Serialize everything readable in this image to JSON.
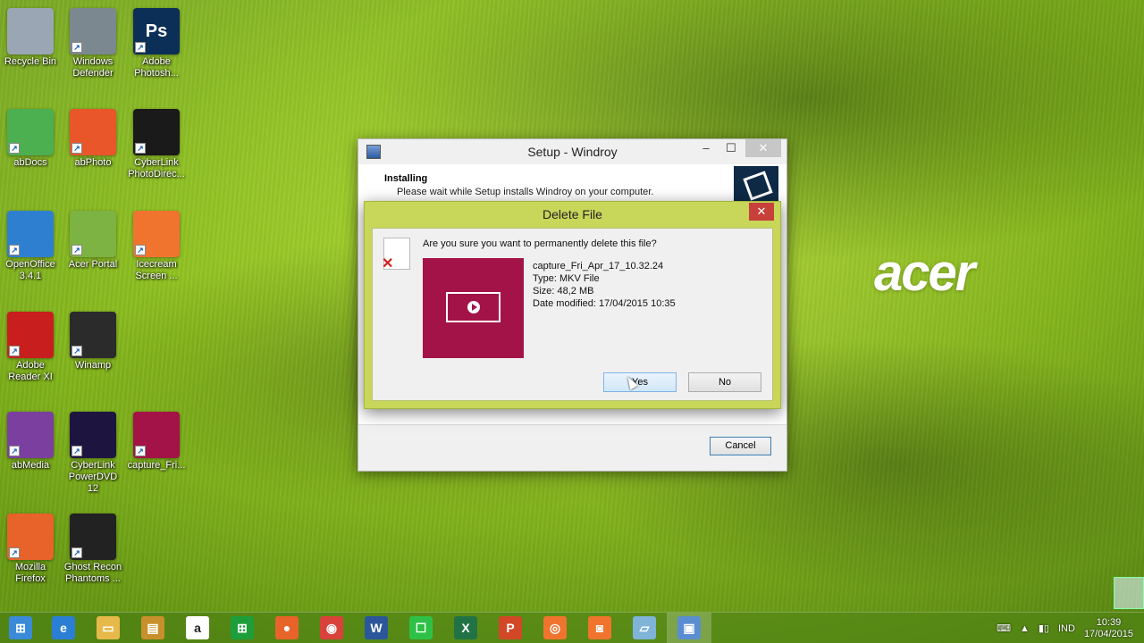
{
  "desktop": {
    "icons": [
      {
        "label": "Recycle Bin",
        "icon": "recycle-bin-icon",
        "color": "#9aa6b3"
      },
      {
        "label": "Windows Defender",
        "icon": "windows-defender-icon",
        "color": "#7c8890"
      },
      {
        "label": "Adobe Photosh...",
        "icon": "photoshop-icon",
        "color": "#0c2f57",
        "glyph": "Ps"
      },
      {
        "label": "abDocs",
        "icon": "abdocs-icon",
        "color": "#4caf50"
      },
      {
        "label": "abPhoto",
        "icon": "abphoto-icon",
        "color": "#e8562a"
      },
      {
        "label": "CyberLink PhotoDirec...",
        "icon": "cyberlink-photodirector-icon",
        "color": "#1a1a1a"
      },
      {
        "label": "OpenOffice 3.4.1",
        "icon": "openoffice-icon",
        "color": "#2f7fd1"
      },
      {
        "label": "Acer Portal",
        "icon": "acer-portal-icon",
        "color": "#7cb342"
      },
      {
        "label": "Icecream Screen ...",
        "icon": "icecream-screen-icon",
        "color": "#f0742e"
      },
      {
        "label": "Adobe Reader XI",
        "icon": "adobe-reader-icon",
        "color": "#c81e1e"
      },
      {
        "label": "Winamp",
        "icon": "winamp-icon",
        "color": "#2b2b2b"
      },
      {
        "label": "abMedia",
        "icon": "abmedia-icon",
        "color": "#7b3fa0"
      },
      {
        "label": "CyberLink PowerDVD 12",
        "icon": "cyberlink-powerdvd-icon",
        "color": "#1d1540"
      },
      {
        "label": "capture_Fri...",
        "icon": "video-file-icon",
        "color": "#a31347"
      },
      {
        "label": "Mozilla Firefox",
        "icon": "firefox-icon",
        "color": "#e8632a"
      },
      {
        "label": "Ghost Recon Phantoms ...",
        "icon": "ghost-recon-icon",
        "color": "#222"
      }
    ],
    "brand": "acer"
  },
  "setup_window": {
    "title": "Setup - Windroy",
    "heading": "Installing",
    "subheading": "Please wait while Setup installs Windroy on your computer.",
    "cancel_label": "Cancel"
  },
  "delete_dialog": {
    "title": "Delete File",
    "question": "Are you sure you want to permanently delete this file?",
    "file_name": "capture_Fri_Apr_17_10.32.24",
    "file_type": "Type: MKV File",
    "file_size": "Size: 48,2 MB",
    "file_modified": "Date modified: 17/04/2015 10:35",
    "yes_label": "Yes",
    "no_label": "No",
    "thumb_color": "#a31347"
  },
  "taskbar": {
    "items": [
      {
        "name": "start-icon",
        "color": "#3a8ad8",
        "glyph": "⊞"
      },
      {
        "name": "internet-explorer-icon",
        "color": "#2a7fd4",
        "glyph": "e"
      },
      {
        "name": "file-explorer-icon",
        "color": "#e6b94a",
        "glyph": "▭"
      },
      {
        "name": "archive-icon",
        "color": "#c8902c",
        "glyph": "▤"
      },
      {
        "name": "amazon-icon",
        "color": "#ffffff",
        "glyph": "a"
      },
      {
        "name": "store-icon",
        "color": "#1e9e3a",
        "glyph": "⊞"
      },
      {
        "name": "firefox-icon",
        "color": "#e8632a",
        "glyph": "●"
      },
      {
        "name": "chrome-icon",
        "color": "#d8423a",
        "glyph": "◉"
      },
      {
        "name": "word-icon",
        "color": "#2b579a",
        "glyph": "W"
      },
      {
        "name": "line-icon",
        "color": "#2fc147",
        "glyph": "☐"
      },
      {
        "name": "excel-icon",
        "color": "#217346",
        "glyph": "X"
      },
      {
        "name": "powerpoint-icon",
        "color": "#d24726",
        "glyph": "P"
      },
      {
        "name": "icecream-icon",
        "color": "#f0742e",
        "glyph": "◎"
      },
      {
        "name": "screenshot-icon",
        "color": "#f0742e",
        "glyph": "◙"
      },
      {
        "name": "window-icon",
        "color": "#7fb3d8",
        "glyph": "▱"
      },
      {
        "name": "setup-windroy-icon",
        "color": "#5b8ed0",
        "glyph": "▣"
      }
    ],
    "language": "IND",
    "time": "10:39",
    "date": "17/04/2015"
  }
}
